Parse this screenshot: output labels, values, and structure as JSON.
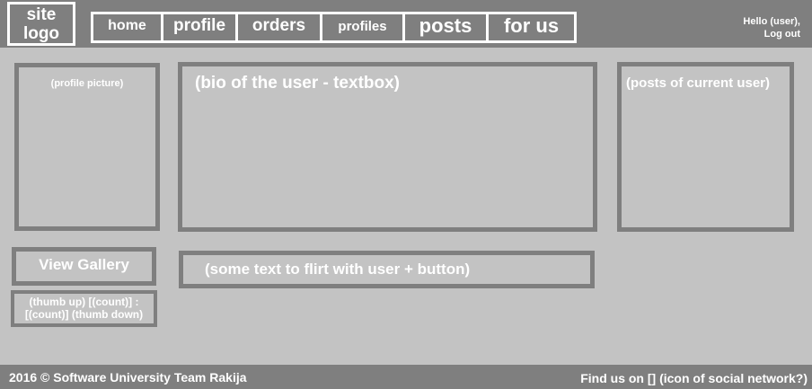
{
  "header": {
    "logo": {
      "line1": "site",
      "line2": "logo"
    },
    "nav": [
      {
        "label": "home"
      },
      {
        "label": "profile"
      },
      {
        "label": "orders"
      },
      {
        "label": "profiles"
      },
      {
        "label": "posts"
      },
      {
        "label": "for us"
      }
    ],
    "user": {
      "greeting": "Hello (user),",
      "logout": "Log out"
    }
  },
  "main": {
    "profile_picture": "(profile picture)",
    "bio": "(bio of the user - textbox)",
    "posts": "(posts of current user)",
    "gallery_button": "View Gallery",
    "votes": {
      "up": "(thumb up) [(count)] :",
      "down": "[(count)] (thumb down)"
    },
    "flirt": "(some text to flirt with user + button)"
  },
  "footer": {
    "copyright": "2016 © Software University Team Rakija",
    "social_prefix": "Find us on ",
    "social_icon": "[]",
    "social_suffix": " (icon of social network?)"
  },
  "colors": {
    "background": "#c3c3c3",
    "bars": "#7f7f7f",
    "text": "#ffffff"
  }
}
